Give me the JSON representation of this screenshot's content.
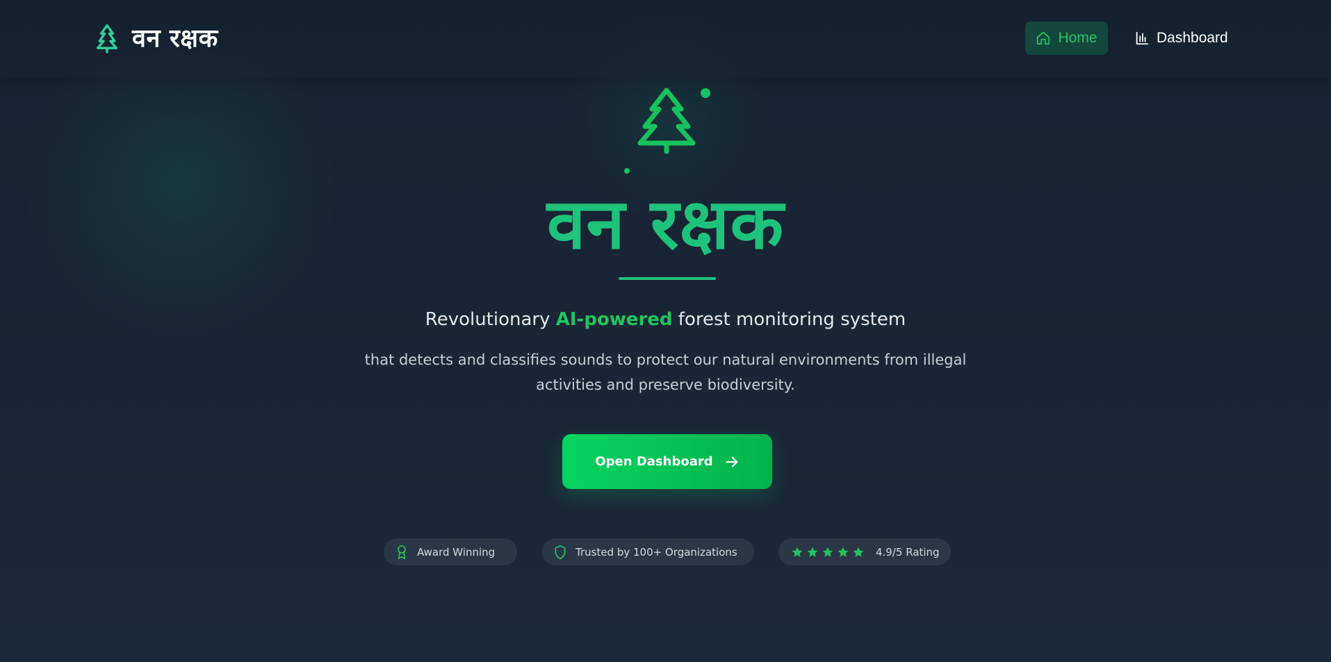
{
  "header": {
    "brand_name": "वन रक्षक",
    "brand_icon": "tree-pine-icon",
    "nav": [
      {
        "label": "Home",
        "icon": "home-icon",
        "active": true
      },
      {
        "label": "Dashboard",
        "icon": "bar-chart-icon",
        "active": false
      }
    ]
  },
  "hero": {
    "icon": "tree-pine-icon",
    "title": "वन रक्षक",
    "tagline_pre": "Revolutionary ",
    "tagline_accent": "AI-powered",
    "tagline_post": " forest monitoring system",
    "description": "that detects and classifies sounds to protect our natural environments from illegal activities and preserve biodiversity.",
    "cta_label": "Open Dashboard",
    "cta_icon": "arrow-right-icon"
  },
  "badges": [
    {
      "label": "Award Winning",
      "icon": "award-icon"
    },
    {
      "label": "Trusted by 100+ Organizations",
      "icon": "shield-icon"
    },
    {
      "label": "4.9/5 Rating",
      "icon": "star-icon",
      "stars": 5
    }
  ],
  "colors": {
    "accent": "#22c55e",
    "title_green": "#1fc27a",
    "background": "#1a2637",
    "badge_bg": "#2b3747",
    "nav_active_bg": "#13473d"
  }
}
